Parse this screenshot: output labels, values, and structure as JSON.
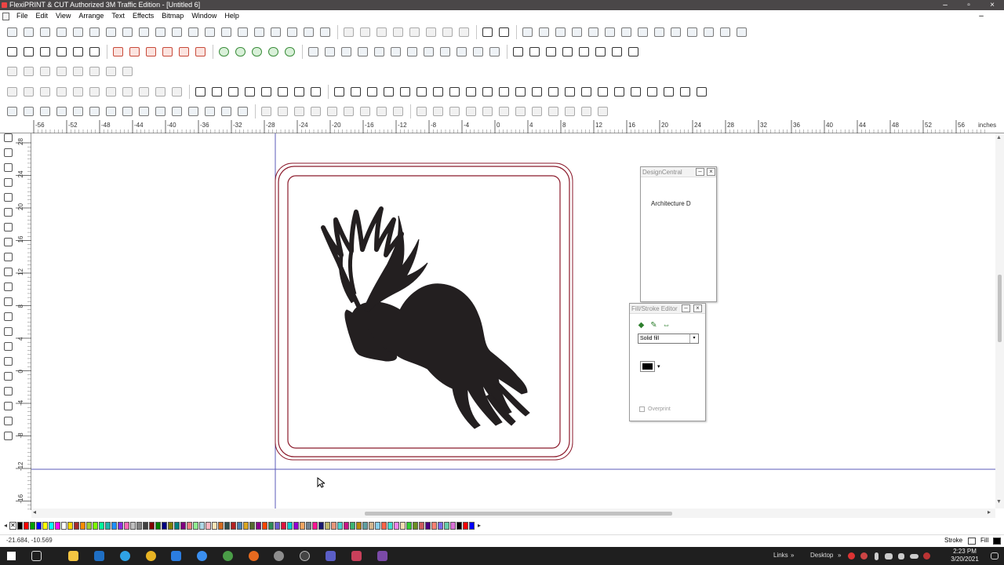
{
  "window": {
    "title": "FlexiPRINT & CUT Authorized 3M Traffic Edition - [Untitled 6]",
    "minimize_icon": "minimize-icon",
    "maximize_icon": "restore-icon",
    "close_icon": "close-icon",
    "doc_minimize_glyph": "–",
    "doc_restore_glyph": "▫",
    "doc_close_glyph": "×"
  },
  "menu": [
    "File",
    "Edit",
    "View",
    "Arrange",
    "Text",
    "Effects",
    "Bitmap",
    "Window",
    "Help"
  ],
  "ruler": {
    "unit": "inches",
    "h_labels": [
      "-56",
      "-52",
      "-48",
      "-44",
      "-40",
      "-36",
      "-32",
      "-28",
      "-24",
      "-20",
      "-16",
      "-12",
      "-8",
      "-4",
      "0",
      "4",
      "8",
      "12",
      "16",
      "20",
      "24",
      "28",
      "32",
      "36",
      "40",
      "44",
      "48",
      "52",
      "56"
    ],
    "v_labels": [
      "28",
      "24",
      "20",
      "16",
      "12",
      "8",
      "4",
      "0",
      "-4",
      "-8",
      "-12",
      "-16"
    ]
  },
  "panels": {
    "design_central": {
      "title": "DesignCentral",
      "item": "Architecture D",
      "minimize_glyph": "–",
      "close_glyph": "×"
    },
    "fill_stroke": {
      "title": "Fill/Stroke Editor",
      "fill_type": "Solid fill",
      "swatch_color": "#000000",
      "overprint_label": "Overprint",
      "minimize_glyph": "–",
      "close_glyph": "×",
      "dropdown_glyph": "▾"
    }
  },
  "artwork": {
    "sign_border_color": "#8b1a2b",
    "silhouette": "elk",
    "silhouette_color": "#231f20"
  },
  "palette": {
    "none_glyph": "✕",
    "scroll_left_glyph": "◂",
    "scroll_right_glyph": "▸",
    "colors": [
      "#000000",
      "#ff0000",
      "#00a000",
      "#0000ff",
      "#ffff00",
      "#00ffff",
      "#ff00ff",
      "#ffffff",
      "#ffd700",
      "#a52a2a",
      "#ff8c00",
      "#9acd32",
      "#7cfc00",
      "#00fa9a",
      "#20b2aa",
      "#1e90ff",
      "#8a2be2",
      "#ff69b4",
      "#c0c0c0",
      "#808080",
      "#404040",
      "#800000",
      "#008000",
      "#000080",
      "#808000",
      "#008080",
      "#800080",
      "#f08080",
      "#90ee90",
      "#add8e6",
      "#ffb6c1",
      "#ffe4b5",
      "#d2691e",
      "#2f4f4f",
      "#b22222",
      "#4682b4",
      "#daa520",
      "#556b2f",
      "#8b008b",
      "#ff4500",
      "#2e8b57",
      "#6a5acd",
      "#dc143c",
      "#00ced1",
      "#9400d3",
      "#f4a460",
      "#708090",
      "#ff1493",
      "#191970",
      "#bdb76b",
      "#e9967a",
      "#48d1cc",
      "#c71585",
      "#3cb371",
      "#b8860b",
      "#5f9ea0",
      "#d2b48c",
      "#87ceeb",
      "#ff6347",
      "#40e0d0",
      "#ee82ee",
      "#f5deb3",
      "#32cd32",
      "#6b8e23",
      "#cd5c5c",
      "#4b0082",
      "#fa8072",
      "#7b68ee",
      "#66cdaa",
      "#da70d6",
      "#000000",
      "#ff0000",
      "#0000ff"
    ]
  },
  "statusbar": {
    "coordinates": "-21.684, -10.569",
    "stroke_label": "Stroke",
    "fill_label": "Fill"
  },
  "taskbar": {
    "links_label": "Links",
    "desktop_label": "Desktop",
    "time": "2:23 PM",
    "date": "3/20/2021",
    "overflow_glyph": "»"
  }
}
